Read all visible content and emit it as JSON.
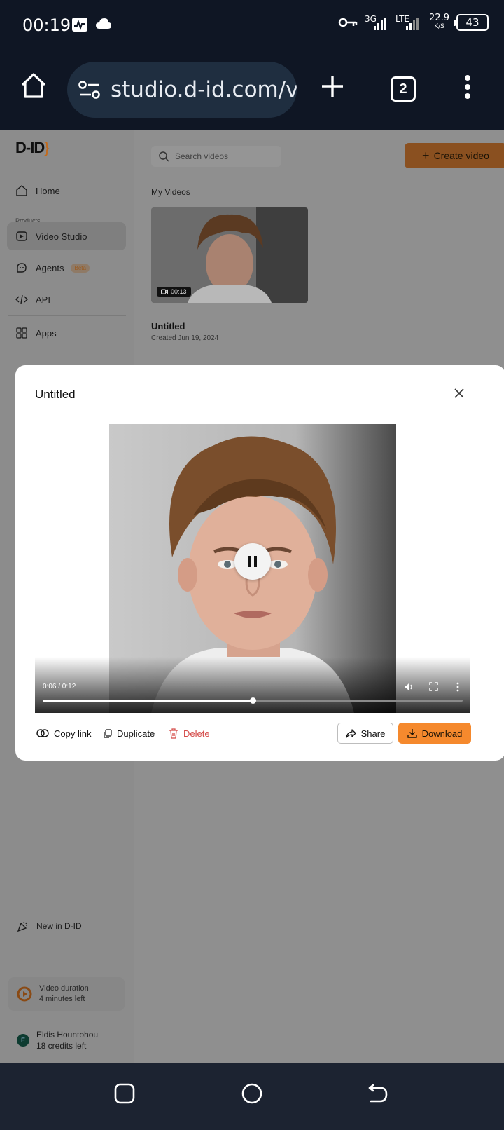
{
  "status_bar": {
    "time": "00:19",
    "net_3g": "3G",
    "net_lte": "LTE",
    "speed_value": "22.9",
    "speed_unit": "K/S",
    "battery": "43"
  },
  "browser": {
    "url": "studio.d-id.com/v",
    "tab_count": "2"
  },
  "sidebar": {
    "logo": "D-ID",
    "items": [
      {
        "label": "Home"
      },
      {
        "label": "Video Studio"
      },
      {
        "label": "Agents",
        "badge": "Beta"
      },
      {
        "label": "API"
      },
      {
        "label": "Apps"
      }
    ],
    "section_label": "Products",
    "new_label": "New in D-ID",
    "video_duration": {
      "title": "Video duration",
      "sub": "4 minutes left"
    },
    "user": {
      "initial": "E",
      "name": "Eldis Hountohou",
      "credits": "18 credits left"
    }
  },
  "main": {
    "search_placeholder": "Search videos",
    "create_label": "Create video",
    "section_title": "My Videos",
    "card": {
      "duration": "00:13",
      "title": "Untitled",
      "date": "Created Jun 19, 2024"
    }
  },
  "modal": {
    "title": "Untitled",
    "time": "0:06 / 0:12",
    "progress": 0.5,
    "actions": {
      "copy": "Copy link",
      "duplicate": "Duplicate",
      "delete": "Delete",
      "share": "Share",
      "download": "Download"
    }
  },
  "colors": {
    "accent": "#f5892d",
    "delete": "#d44a48",
    "status_bg": "#0f1624"
  }
}
